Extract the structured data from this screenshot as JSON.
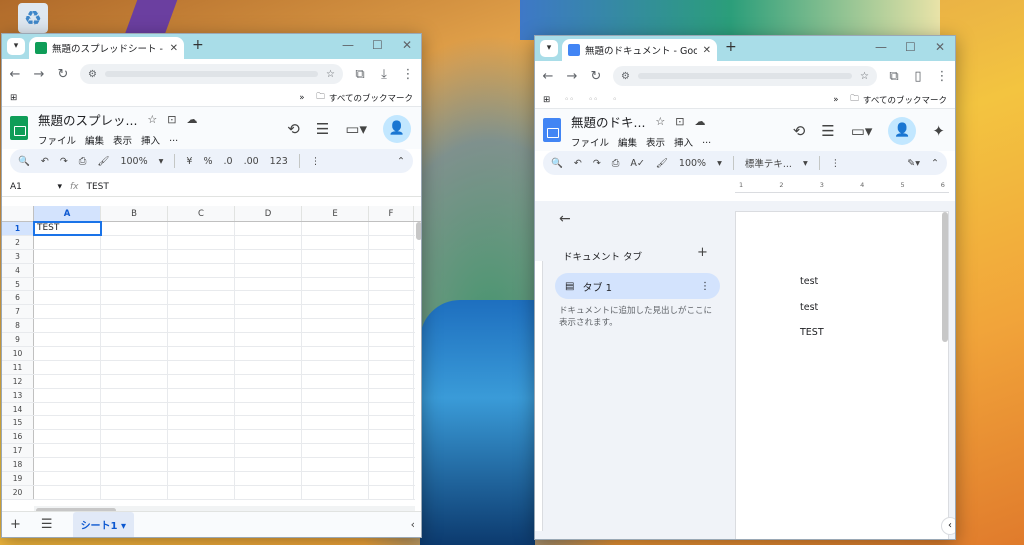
{
  "desktop": {
    "recycle_bin_icon": "recycle-bin-icon"
  },
  "sheets_window": {
    "tab_title": "無題のスプレッドシート - Google ス",
    "bookmarks_label": "すべてのブックマーク",
    "doc_title": "無題のスプレッ...",
    "menus": [
      "ファイル",
      "編集",
      "表示",
      "挿入",
      "..."
    ],
    "toolbar": {
      "zoom": "100%",
      "currency": "¥",
      "percent": "%",
      "dec_decrease": ".0",
      "dec_increase": ".00",
      "format_123": "123"
    },
    "cell_ref": "A1",
    "formula_content": "TEST",
    "columns": [
      "A",
      "B",
      "C",
      "D",
      "E",
      "F"
    ],
    "rows": [
      "1",
      "2",
      "3",
      "4",
      "5",
      "6",
      "7",
      "8",
      "9",
      "10",
      "11",
      "12",
      "13",
      "14",
      "15",
      "16",
      "17",
      "18",
      "19",
      "20"
    ],
    "cell_a1": "TEST",
    "sheet_tab": "シート1"
  },
  "docs_window": {
    "tab_title": "無題のドキュメント - Google ドキュ",
    "bookmarks_label": "すべてのブックマーク",
    "doc_title": "無題のドキ...",
    "menus": [
      "ファイル",
      "編集",
      "表示",
      "挿入",
      "..."
    ],
    "toolbar": {
      "zoom": "100%",
      "style": "標準テキ..."
    },
    "ruler_marks": [
      "1",
      "2",
      "3",
      "4",
      "5",
      "6"
    ],
    "outline_title": "ドキュメント タブ",
    "tab_name": "タブ 1",
    "outline_hint": "ドキュメントに追加した見出しがここに表示されます。",
    "page_lines": [
      "test",
      "test",
      "TEST"
    ]
  }
}
